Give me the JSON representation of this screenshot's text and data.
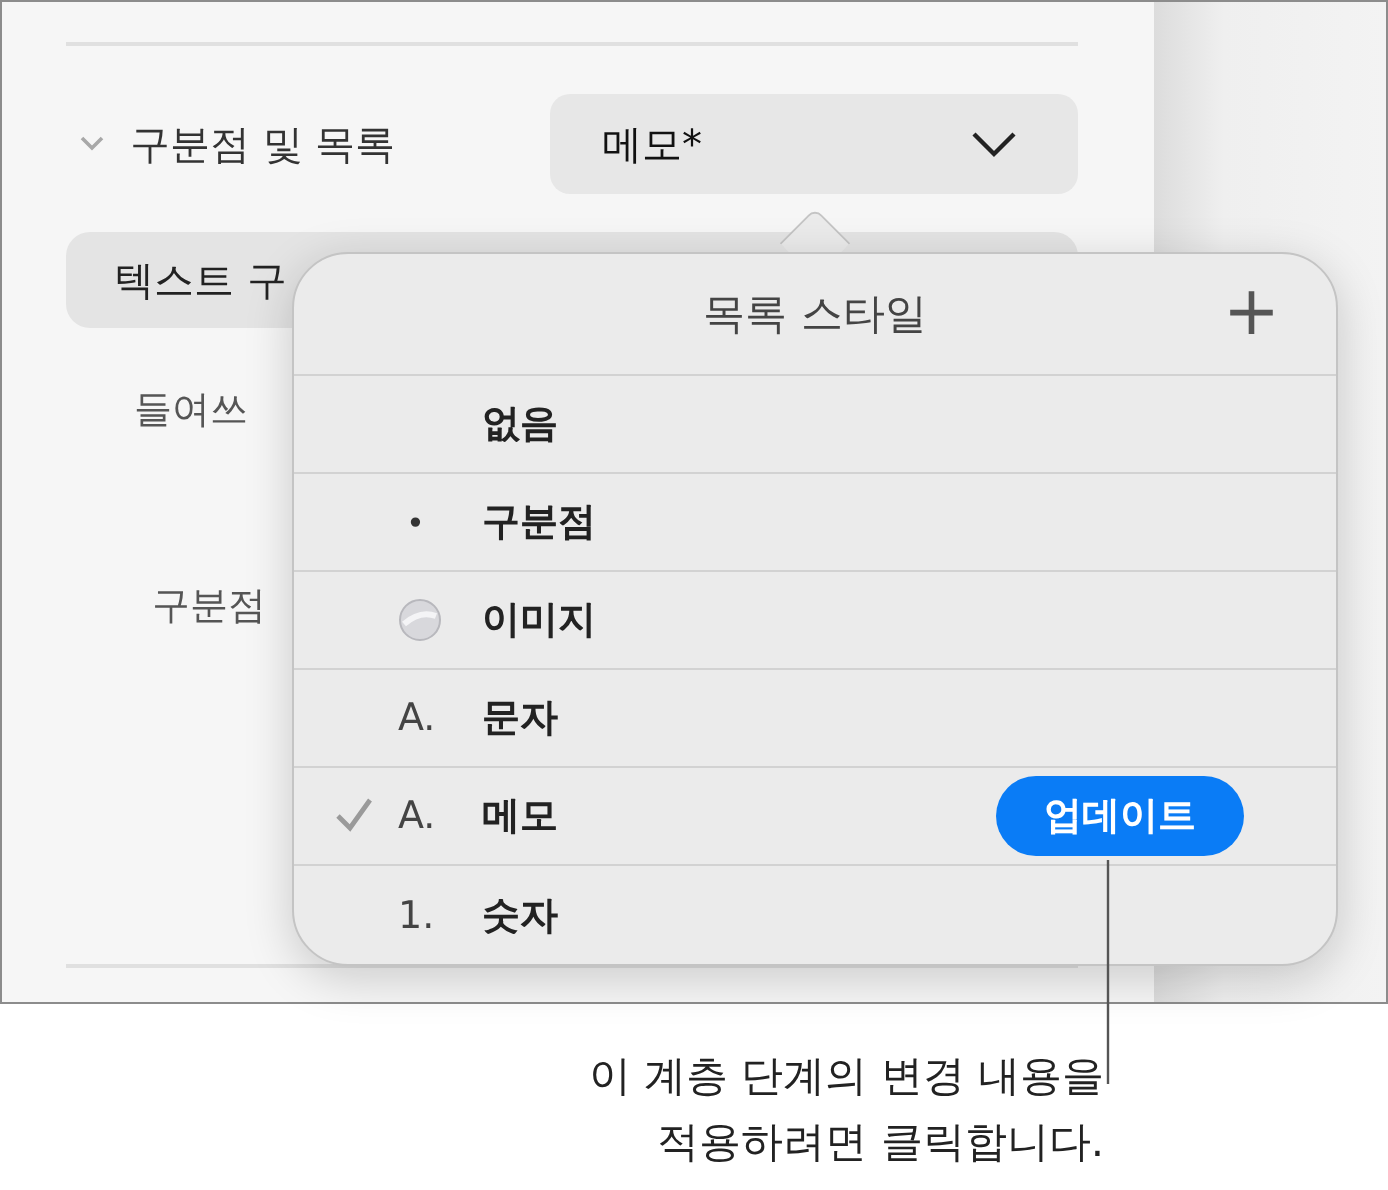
{
  "section": {
    "title": "구분점 및 목록",
    "expanded": true,
    "style_value": "메모*"
  },
  "background_controls": [
    {
      "kind": "pill",
      "text": "텍스트 구"
    },
    {
      "kind": "label",
      "text": "들여쓰"
    },
    {
      "kind": "label",
      "text": "구분점"
    }
  ],
  "popover": {
    "title": "목록 스타일",
    "add": "+",
    "items": [
      {
        "kind": "none",
        "label": "없음",
        "selected": false
      },
      {
        "kind": "bullet",
        "marker": "•",
        "label": "구분점",
        "selected": false
      },
      {
        "kind": "image",
        "label": "이미지",
        "selected": false
      },
      {
        "kind": "letter",
        "marker": "A.",
        "label": "문자",
        "selected": false
      },
      {
        "kind": "letter",
        "marker": "A.",
        "label": "메모",
        "selected": true,
        "action": "업데이트"
      },
      {
        "kind": "number",
        "marker": "1.",
        "label": "숫자",
        "selected": false
      }
    ]
  },
  "callout": "이 계층 단계의 변경 내용을 적용하려면 클릭합니다."
}
